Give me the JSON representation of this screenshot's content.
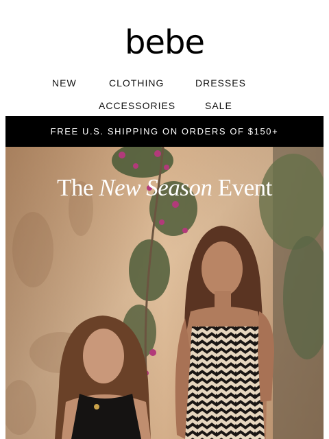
{
  "brand": {
    "logo_text": "bebe"
  },
  "nav": {
    "row1": [
      "NEW",
      "CLOTHING",
      "DRESSES"
    ],
    "row2": [
      "ACCESSORIES",
      "SALE"
    ]
  },
  "promo_bar": {
    "text": "FREE U.S. SHIPPING ON ORDERS OF $150+",
    "background": "#000000",
    "color": "#ffffff"
  },
  "hero": {
    "title_part1": "The ",
    "title_italic": "New Season",
    "title_part2": " Event",
    "image_subject": "two models in black dress and black-cream chevron knit dress against sunlit wall with bougainvillea"
  },
  "colors": {
    "wall": "#d9b48f",
    "foliage": "#4f5d3a",
    "blossom": "#b23a7a"
  }
}
